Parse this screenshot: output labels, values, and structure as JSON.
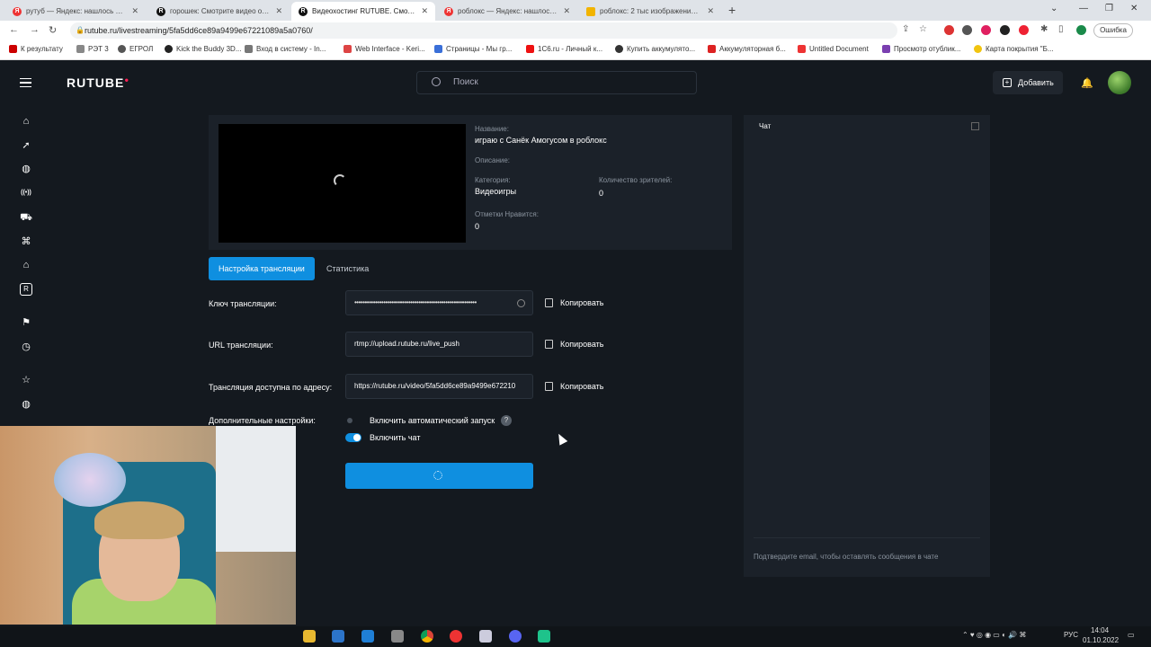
{
  "browser": {
    "tabs": [
      {
        "title": "рутуб — Яндекс: нашлось 4 млн",
        "fav": "#e33",
        "letter": "Я"
      },
      {
        "title": "горошек: Смотрите видео онлайн",
        "fav": "#111",
        "letter": "R"
      },
      {
        "title": "Видеохостинг RUTUBE. Смотрите",
        "fav": "#111",
        "letter": "R"
      },
      {
        "title": "роблокс — Яндекс: нашлось 6 млн",
        "fav": "#e33",
        "letter": "Я"
      },
      {
        "title": "роблокс: 2 тыс изображений най",
        "fav": "#f2b400",
        "letter": ""
      }
    ],
    "url": "rutube.ru/livestreaming/5fa5dd6ce89a9499e67221089a5a0760/",
    "profile": "Ошибка",
    "bookmarks": [
      "К результату",
      "РЭТ 3",
      "ЕГРОЛ",
      "Kick the Buddy 3D...",
      "Вход в систему - In...",
      "Web Interface - Keri...",
      "Страницы - Мы гр...",
      "1С6.ru - Личный к...",
      "Купить аккумулято...",
      "Аккумуляторная б...",
      "Untitled Document",
      "Просмотр отублик...",
      "Карта покрытия \"Б..."
    ]
  },
  "header": {
    "logo": "RUTUBE",
    "search_placeholder": "Поиск",
    "add_label": "Добавить"
  },
  "stream": {
    "name_label": "Название:",
    "name_value": "играю с Санёк Амогусом в роблокс",
    "desc_label": "Описание:",
    "category_label": "Категория:",
    "category_value": "Видеоигры",
    "viewers_label": "Количество зрителей:",
    "viewers_value": "0",
    "likes_label": "Отметки Нравится:",
    "likes_value": "0"
  },
  "tabs": {
    "settings": "Настройка трансляции",
    "stats": "Статистика"
  },
  "form": {
    "key_label": "Ключ трансляции:",
    "key_value": "•••••••••••••••••••••••••••••••••••••••••••••••••••••••••••",
    "url_label": "URL трансляции:",
    "url_value": "rtmp://upload.rutube.ru/live_push",
    "address_label": "Трансляция доступна по адресу:",
    "address_value": "https://rutube.ru/video/5fa5dd6ce89a9499e672210",
    "copy": "Копировать",
    "extra_label": "Дополнительные настройки:",
    "autostart_label": "Включить автоматический запуск",
    "autostart_on": false,
    "chat_label": "Включить чат",
    "chat_on": true,
    "help": "?"
  },
  "chat": {
    "title": "Чат",
    "hint": "Подтвердите email, чтобы оставлять сообщения в чате"
  },
  "taskbar": {
    "lang": "РУС",
    "time": "14:04",
    "date": "01.10.2022"
  },
  "colors": {
    "accent": "#0f8fe0",
    "bg": "#14191f",
    "card": "#1b2129"
  }
}
